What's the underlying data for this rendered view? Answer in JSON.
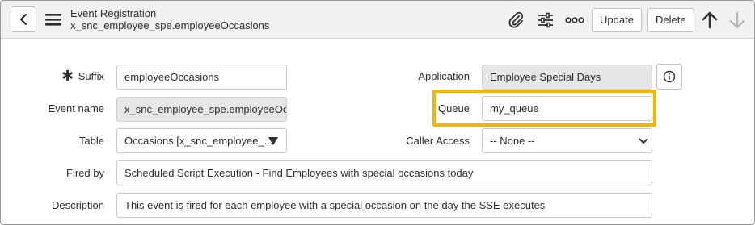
{
  "header": {
    "title": "Event Registration",
    "subtitle": "x_snc_employee_spe.employeeOccasions",
    "update_label": "Update",
    "delete_label": "Delete"
  },
  "form": {
    "suffix": {
      "label": "Suffix",
      "value": "employeeOccasions",
      "required_mark": "✱"
    },
    "application": {
      "label": "Application",
      "value": "Employee Special Days"
    },
    "event_name": {
      "label": "Event name",
      "value": "x_snc_employee_spe.employeeOccasions"
    },
    "queue": {
      "label": "Queue",
      "value": "my_queue"
    },
    "table": {
      "label": "Table",
      "value": "Occasions [x_snc_employee_..."
    },
    "caller_access": {
      "label": "Caller Access",
      "value": "-- None --"
    },
    "fired_by": {
      "label": "Fired by",
      "value": "Scheduled Script Execution - Find Employees with special occasions today"
    },
    "description": {
      "label": "Description",
      "value": "This event is fired for each employee with a special occasion on the day the SSE executes"
    }
  },
  "colors": {
    "highlight": "#f2b705",
    "header_bg": "#f1f1f1",
    "readonly_bg": "#e6e6e6"
  },
  "icons": [
    "chevron-left-icon",
    "hamburger-menu-icon",
    "paperclip-icon",
    "sliders-icon",
    "more-dots-icon",
    "arrow-up-icon",
    "arrow-down-icon",
    "info-icon",
    "dropdown-caret-icon"
  ]
}
